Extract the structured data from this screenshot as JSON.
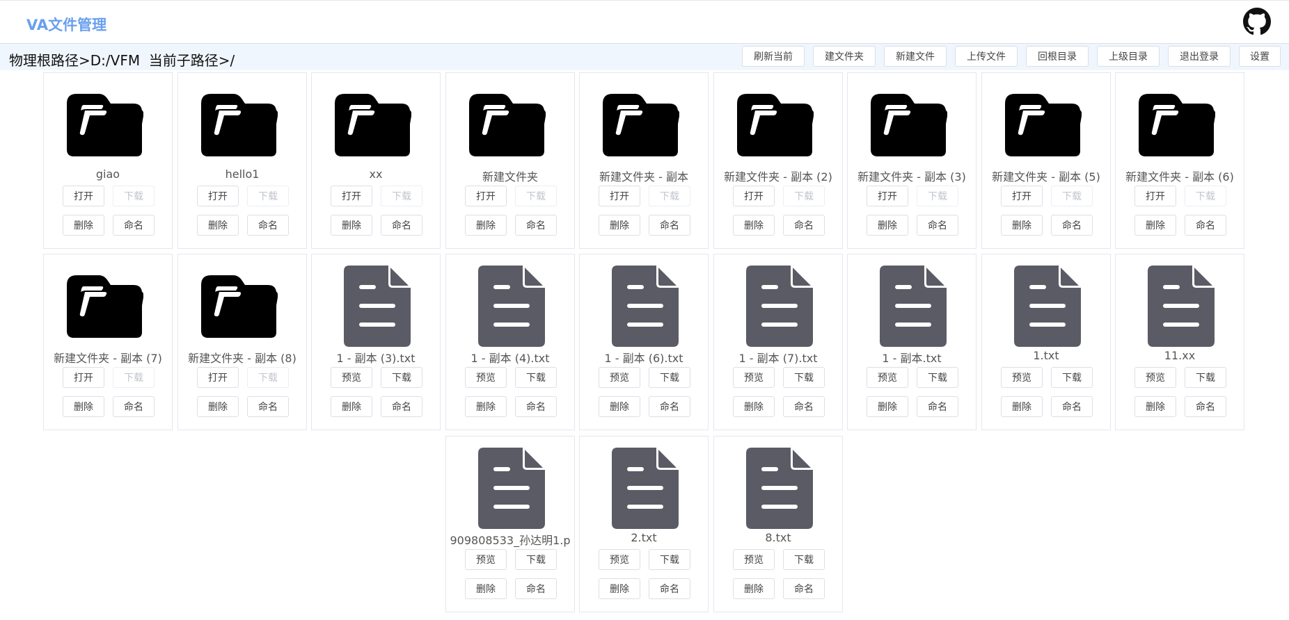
{
  "header": {
    "brand": "VA文件管理",
    "github_icon": "github-icon"
  },
  "pathbar": {
    "path_text": "物理根路径>D:/VFM  当前子路径>/",
    "buttons": [
      "刷新当前",
      "建文件夹",
      "新建文件",
      "上传文件",
      "回根目录",
      "上级目录",
      "退出登录",
      "设置"
    ]
  },
  "icons": {
    "folder": "folder-icon",
    "file": "text-file-icon"
  },
  "colors": {
    "brand": "#6a9ff0",
    "folder": "#000000",
    "file": "#5b5b66",
    "pathbar_bg": "#f0f6fd"
  },
  "folder_actions": {
    "open": "打开",
    "download": "下载",
    "delete": "删除",
    "rename": "命名"
  },
  "file_actions": {
    "preview": "预览",
    "download": "下载",
    "delete": "删除",
    "rename": "命名"
  },
  "items": [
    {
      "name": "giao",
      "type": "folder"
    },
    {
      "name": "hello1",
      "type": "folder"
    },
    {
      "name": "xx",
      "type": "folder"
    },
    {
      "name": "新建文件夹",
      "type": "folder"
    },
    {
      "name": "新建文件夹 - 副本",
      "type": "folder"
    },
    {
      "name": "新建文件夹 - 副本 (2)",
      "type": "folder"
    },
    {
      "name": "新建文件夹 - 副本 (3)",
      "type": "folder"
    },
    {
      "name": "新建文件夹 - 副本 (5)",
      "type": "folder"
    },
    {
      "name": "新建文件夹 - 副本 (6)",
      "type": "folder"
    },
    {
      "name": "新建文件夹 - 副本 (7)",
      "type": "folder"
    },
    {
      "name": "新建文件夹 - 副本 (8)",
      "type": "folder"
    },
    {
      "name": "1 - 副本 (3).txt",
      "type": "file"
    },
    {
      "name": "1 - 副本 (4).txt",
      "type": "file"
    },
    {
      "name": "1 - 副本 (6).txt",
      "type": "file"
    },
    {
      "name": "1 - 副本 (7).txt",
      "type": "file"
    },
    {
      "name": "1 - 副本.txt",
      "type": "file"
    },
    {
      "name": "1.txt",
      "type": "file"
    },
    {
      "name": "11.xx",
      "type": "file"
    },
    {
      "name": "909808533_孙达明1.p",
      "type": "file"
    },
    {
      "name": "2.txt",
      "type": "file"
    },
    {
      "name": "8.txt",
      "type": "file"
    }
  ]
}
